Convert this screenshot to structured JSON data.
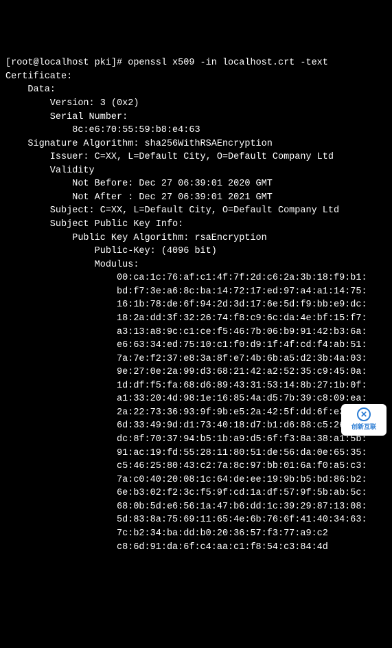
{
  "prompt": "[root@localhost pki]# ",
  "command": "openssl x509 -in localhost.crt -text",
  "lines": [
    "Certificate:",
    "    Data:",
    "        Version: 3 (0x2)",
    "        Serial Number:",
    "            8c:e6:70:55:59:b8:e4:63",
    "    Signature Algorithm: sha256WithRSAEncryption",
    "        Issuer: C=XX, L=Default City, O=Default Company Ltd",
    "        Validity",
    "            Not Before: Dec 27 06:39:01 2020 GMT",
    "            Not After : Dec 27 06:39:01 2021 GMT",
    "        Subject: C=XX, L=Default City, O=Default Company Ltd",
    "        Subject Public Key Info:",
    "            Public Key Algorithm: rsaEncryption",
    "                Public-Key: (4096 bit)",
    "                Modulus:",
    "                    00:ca:1c:76:af:c1:4f:7f:2d:c6:2a:3b:18:f9:b1:",
    "                    bd:f7:3e:a6:8c:ba:14:72:17:ed:97:a4:a1:14:75:",
    "                    16:1b:78:de:6f:94:2d:3d:17:6e:5d:f9:bb:e9:dc:",
    "                    18:2a:dd:3f:32:26:74:f8:c9:6c:da:4e:bf:15:f7:",
    "                    a3:13:a8:9c:c1:ce:f5:46:7b:06:b9:91:42:b3:6a:",
    "                    e6:63:34:ed:75:10:c1:f0:d9:1f:4f:cd:f4:ab:51:",
    "                    7a:7e:f2:37:e8:3a:8f:e7:4b:6b:a5:d2:3b:4a:03:",
    "                    9e:27:0e:2a:99:d3:68:21:42:a2:52:35:c9:45:0a:",
    "                    1d:df:f5:fa:68:d6:89:43:31:53:14:8b:27:1b:0f:",
    "                    a1:33:20:4d:98:1e:16:85:4a:d5:7b:39:c8:09:ea:",
    "                    2a:22:73:36:93:9f:9b:e5:2a:42:5f:dd:6f:e3:e8:",
    "                    6d:33:49:9d:d1:73:40:18:d7:b1:d6:88:c5:26:0d:",
    "                    dc:8f:70:37:94:b5:1b:a9:d5:6f:f3:8a:38:a1:5b:",
    "                    91:ac:19:fd:55:28:11:80:51:de:56:da:0e:65:35:",
    "                    c5:46:25:80:43:c2:7a:8c:97:bb:01:6a:f0:a5:c3:",
    "                    7a:c0:40:20:08:1c:64:de:ee:19:9b:b5:bd:86:b2:",
    "                    6e:b3:02:f2:3c:f5:9f:cd:1a:df:57:9f:5b:ab:5c:",
    "                    68:0b:5d:e6:56:1a:47:b6:dd:1c:39:29:87:13:08:",
    "                    5d:83:8a:75:69:11:65:4e:6b:76:6f:41:40:34:63:",
    "                    7c:b2:34:ba:dd:b0:20:36:57:f3:77:a9:c2",
    "                    c8:6d:91:da:6f:c4:aa:c1:f8:54:c3:84:4d"
  ],
  "watermark": {
    "text": "创新互联"
  }
}
